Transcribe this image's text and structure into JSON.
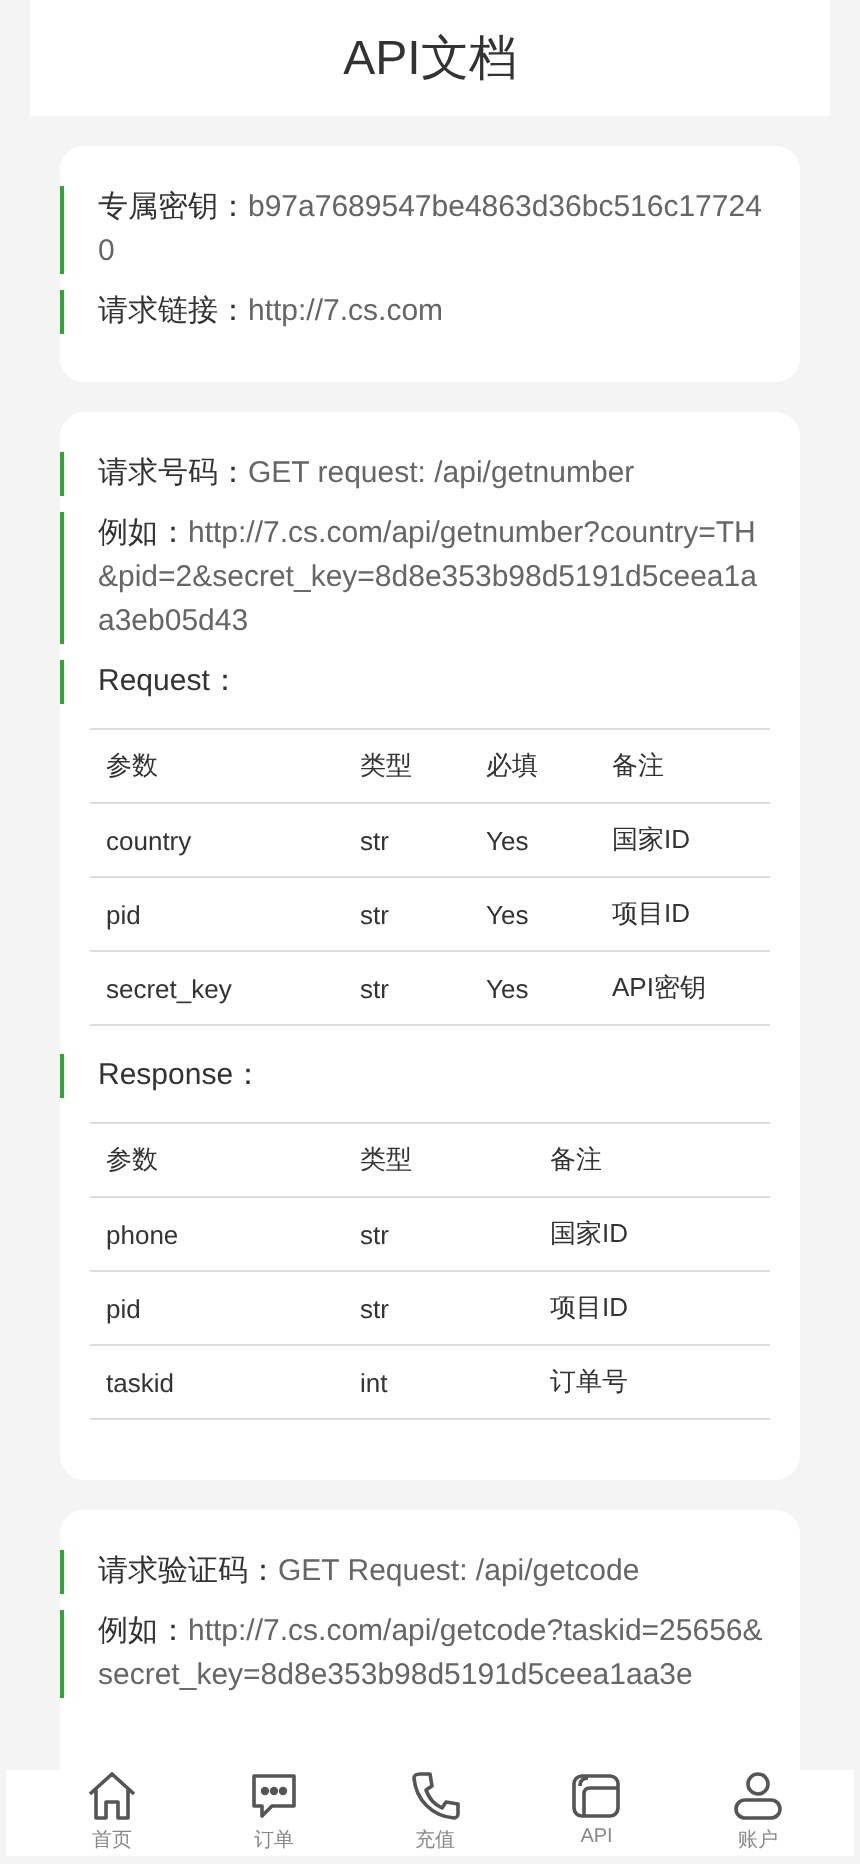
{
  "header": {
    "title": "API文档"
  },
  "cards": [
    {
      "items": [
        {
          "kind": "field",
          "label": "专属密钥：",
          "value": "b97a7689547be4863d36bc516c177240"
        },
        {
          "kind": "field",
          "label": "请求链接：",
          "value": "http://7.cs.com"
        }
      ]
    },
    {
      "items": [
        {
          "kind": "field",
          "label": "请求号码：",
          "value": "GET request: /api/getnumber"
        },
        {
          "kind": "field",
          "label": "例如：",
          "value": "http://7.cs.com/api/getnumber?country=TH&pid=2&secret_key=8d8e353b98d5191d5ceea1aa3eb05d43"
        },
        {
          "kind": "table",
          "heading": "Request：",
          "columns": [
            "参数",
            "类型",
            "必填",
            "备注"
          ],
          "rows": [
            [
              "country",
              "str",
              "Yes",
              "国家ID"
            ],
            [
              "pid",
              "str",
              "Yes",
              "项目ID"
            ],
            [
              "secret_key",
              "str",
              "Yes",
              "API密钥"
            ]
          ]
        },
        {
          "kind": "table",
          "heading": "Response：",
          "columns": [
            "参数",
            "类型",
            "备注"
          ],
          "rows": [
            [
              "phone",
              "str",
              "国家ID"
            ],
            [
              "pid",
              "str",
              "项目ID"
            ],
            [
              "taskid",
              "int",
              "订单号"
            ]
          ]
        }
      ]
    },
    {
      "items": [
        {
          "kind": "field",
          "label": "请求验证码：",
          "value": "GET Request: /api/getcode"
        },
        {
          "kind": "field",
          "label": "例如：",
          "value": "http://7.cs.com/api/getcode?taskid=25656&secret_key=8d8e353b98d5191d5ceea1aa3e"
        }
      ]
    }
  ],
  "nav": [
    {
      "kind": "home",
      "label": "首页",
      "selected": false
    },
    {
      "kind": "chat",
      "label": "订单",
      "selected": false
    },
    {
      "kind": "phone",
      "label": "充值",
      "selected": false
    },
    {
      "kind": "wallet",
      "label": "API",
      "selected": false
    },
    {
      "kind": "user",
      "label": "账户",
      "selected": false
    }
  ]
}
